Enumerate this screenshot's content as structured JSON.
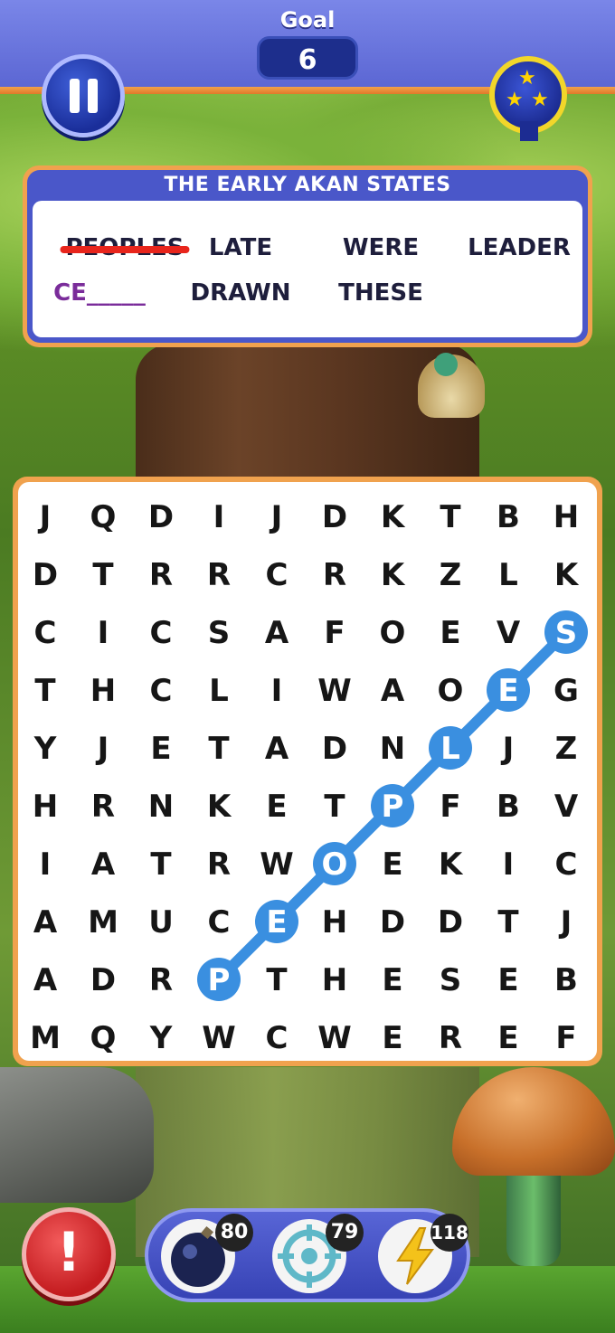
{
  "header": {
    "goal_label": "Goal",
    "goal_value": "6"
  },
  "panel": {
    "title": "THE EARLY AKAN STATES",
    "words": [
      {
        "text": "PEOPLES",
        "state": "found"
      },
      {
        "text": "LATE",
        "state": "pending"
      },
      {
        "text": "WERE",
        "state": "pending"
      },
      {
        "text": "LEADER",
        "state": "pending"
      },
      {
        "text": "CE_____",
        "state": "partial"
      },
      {
        "text": "DRAWN",
        "state": "pending"
      },
      {
        "text": "THESE",
        "state": "pending"
      }
    ]
  },
  "grid": {
    "rows": [
      [
        "J",
        "Q",
        "D",
        "I",
        "J",
        "D",
        "K",
        "T",
        "B",
        "H"
      ],
      [
        "D",
        "T",
        "R",
        "R",
        "C",
        "R",
        "K",
        "Z",
        "L",
        "K"
      ],
      [
        "C",
        "I",
        "C",
        "S",
        "A",
        "F",
        "O",
        "E",
        "V",
        "S"
      ],
      [
        "T",
        "H",
        "C",
        "L",
        "I",
        "W",
        "A",
        "O",
        "E",
        "G"
      ],
      [
        "Y",
        "J",
        "E",
        "T",
        "A",
        "D",
        "N",
        "L",
        "J",
        "Z"
      ],
      [
        "H",
        "R",
        "N",
        "K",
        "E",
        "T",
        "P",
        "F",
        "B",
        "V"
      ],
      [
        "I",
        "A",
        "T",
        "R",
        "W",
        "O",
        "E",
        "K",
        "I",
        "C"
      ],
      [
        "A",
        "M",
        "U",
        "C",
        "E",
        "H",
        "D",
        "D",
        "T",
        "J"
      ],
      [
        "A",
        "D",
        "R",
        "P",
        "T",
        "H",
        "E",
        "S",
        "E",
        "B"
      ],
      [
        "M",
        "Q",
        "Y",
        "W",
        "C",
        "W",
        "E",
        "R",
        "E",
        "F"
      ]
    ],
    "selection": [
      [
        8,
        3
      ],
      [
        7,
        4
      ],
      [
        6,
        5
      ],
      [
        5,
        6
      ],
      [
        4,
        7
      ],
      [
        3,
        8
      ],
      [
        2,
        9
      ]
    ],
    "selection_color": "#3a8fe0"
  },
  "powerups": [
    {
      "name": "bomb",
      "count": "80"
    },
    {
      "name": "target",
      "count": "79"
    },
    {
      "name": "lightning",
      "count": "118"
    }
  ],
  "colors": {
    "header": "#6672dc",
    "panel_border": "#f0a24e",
    "alert": "#d42a2e",
    "strike": "#e8251c"
  }
}
